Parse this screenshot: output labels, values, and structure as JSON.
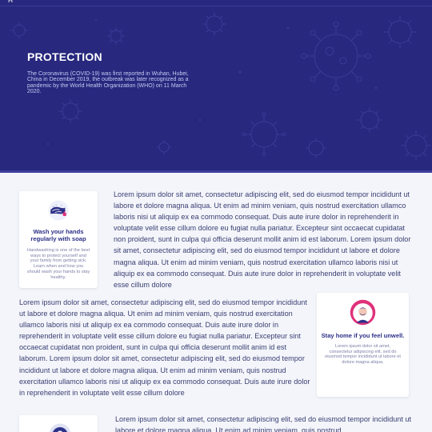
{
  "hero": {
    "title": "PROTECTION",
    "description": "The Coronavirus (COVID-19) was first reported in Wuhan, Hubei, China in December 2019, the outbreak was later recognized as a pandemic by the World Health Organization (WHO) on 11 March 2020."
  },
  "sections": [
    {
      "card": {
        "icon": "handwashing-icon",
        "title": "Wash your hands regularly with soap",
        "text": "Handwashing is one of the best ways to protect yourself and your family from getting sick. Learn when and how you should wash your hands to stay healthy."
      },
      "paragraph": "Lorem ipsum dolor sit amet, consectetur adipiscing elit, sed do eiusmod tempor incididunt ut labore et dolore magna aliqua. Ut enim ad minim veniam, quis nostrud exercitation ullamco laboris nisi ut aliquip ex ea commodo consequat. Duis aute irure dolor in reprehenderit in voluptate velit esse cillum dolore eu fugiat nulla pariatur. Excepteur sint occaecat cupidatat non proident, sunt in culpa qui officia deserunt mollit anim id est laborum. Lorem ipsum dolor sit amet, consectetur adipiscing elit, sed do eiusmod tempor incididunt ut labore et dolore magna aliqua. Ut enim ad minim veniam, quis nostrud exercitation ullamco laboris nisi ut aliquip ex ea commodo consequat. Duis aute irure dolor in reprehenderit in voluptate velit esse cillum dolore"
    },
    {
      "card": {
        "icon": "stay-home-person-icon",
        "title": "Stay home if you feel unwell.",
        "text": "Lorem ipsum dolor sit amet, consectetur adipiscing elit, sed do eiusmod tempor incididunt ut labore et dolore magna aliqua."
      },
      "paragraph": "Lorem ipsum dolor sit amet, consectetur adipiscing elit, sed do eiusmod tempor incididunt ut labore et dolore magna aliqua. Ut enim ad minim veniam, quis nostrud exercitation ullamco laboris nisi ut aliquip ex ea commodo consequat. Duis aute irure dolor in reprehenderit in voluptate velit esse cillum dolore eu fugiat nulla pariatur. Excepteur sint occaecat cupidatat non proident, sunt in culpa qui officia deserunt mollit anim id est laborum. Lorem ipsum dolor sit amet, consectetur adipiscing elit, sed do eiusmod tempor incididunt ut labore et dolore magna aliqua. Ut enim ad minim veniam, quis nostrud exercitation ullamco laboris nisi ut aliquip ex ea commodo consequat. Duis aute irure dolor in reprehenderit in voluptate velit esse cillum dolore"
    },
    {
      "card": {
        "icon": "person-icon"
      },
      "paragraph": "Lorem ipsum dolor sit amet, consectetur adipiscing elit, sed do eiusmod tempor incididunt ut labore et dolore magna aliqua. Ut enim ad minim veniam, quis nostrud"
    }
  ],
  "colors": {
    "hero_bg": "#27287e",
    "accent": "#2c2f86",
    "icon_pink": "#e0317a",
    "page_bg": "#f3f5fa"
  }
}
